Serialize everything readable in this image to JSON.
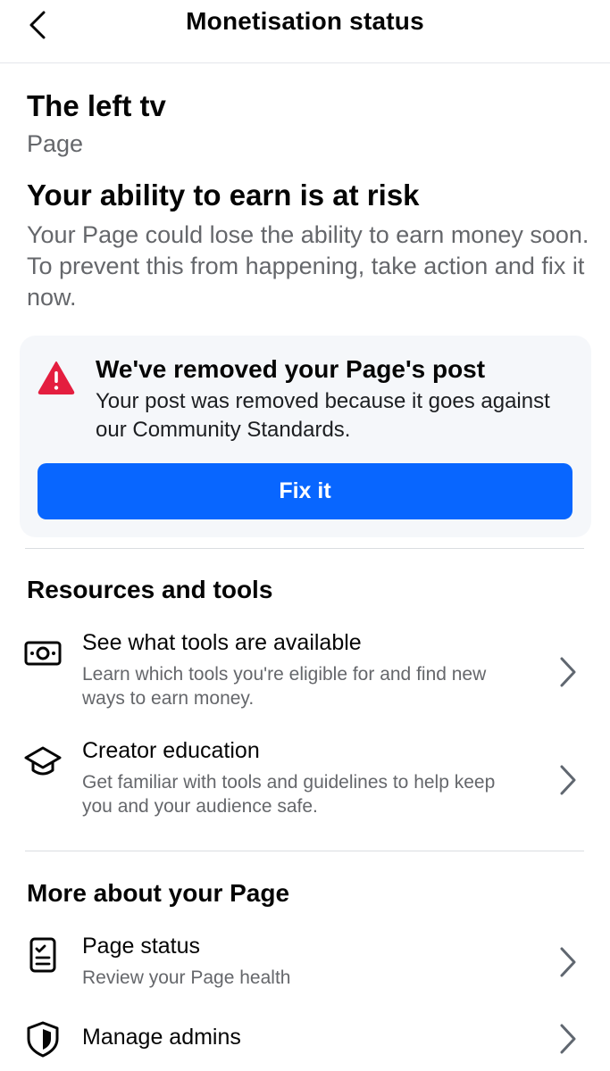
{
  "header": {
    "title": "Monetisation status",
    "back_icon": "chevron-left-icon"
  },
  "page": {
    "name": "The left tv",
    "type": "Page"
  },
  "risk": {
    "title": "Your ability to earn is at risk",
    "description": "Your Page could lose the ability to earn money soon. To prevent this from happening, take action and fix it now."
  },
  "alert": {
    "icon": "warning-triangle-icon",
    "title": "We've removed your Page's post",
    "description": "Your post was removed because it goes against our Community Standards.",
    "button_label": "Fix it"
  },
  "resources": {
    "title": "Resources and tools",
    "items": [
      {
        "icon": "money-icon",
        "title": "See what tools are available",
        "subtitle": "Learn which tools you're eligible for and find new ways to earn money."
      },
      {
        "icon": "graduation-cap-icon",
        "title": "Creator education",
        "subtitle": "Get familiar with tools and guidelines to help keep you and your audience safe."
      }
    ]
  },
  "more": {
    "title": "More about your Page",
    "items": [
      {
        "icon": "clipboard-checklist-icon",
        "title": "Page status",
        "subtitle": "Review your Page health"
      },
      {
        "icon": "shield-icon",
        "title": "Manage admins",
        "subtitle": ""
      }
    ]
  },
  "colors": {
    "primary_button": "#0866ff",
    "warning_red": "#e41e3f",
    "secondary_text": "#65676b",
    "card_background": "#f5f7fa"
  }
}
